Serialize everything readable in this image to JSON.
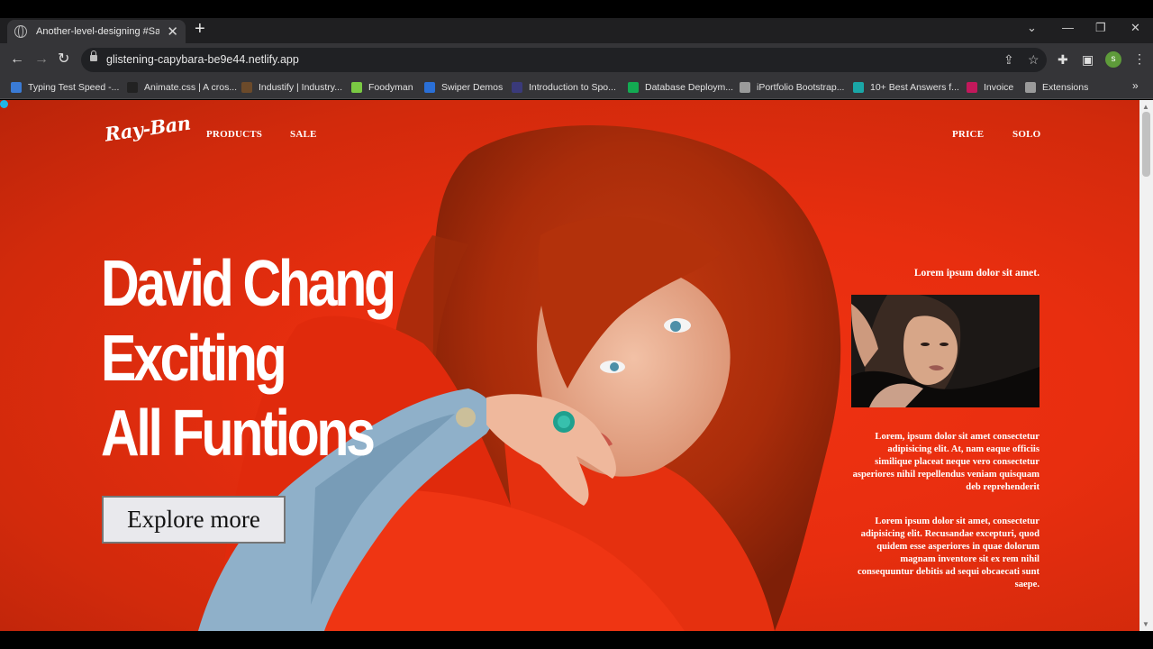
{
  "browser": {
    "tab_title": "Another-level-designing #Sagar",
    "url": "glistening-capybara-be9e44.netlify.app",
    "profile_initial": "s",
    "bookmarks": [
      {
        "label": "Typing Test Speed -...",
        "color": "#3a7bd5"
      },
      {
        "label": "Animate.css | A cros...",
        "color": "#222222"
      },
      {
        "label": "Industify | Industry...",
        "color": "#6b4a2a"
      },
      {
        "label": "Foodyman",
        "color": "#7ac943"
      },
      {
        "label": "Swiper Demos",
        "color": "#2a6fd6"
      },
      {
        "label": "Introduction to Spo...",
        "color": "#3a3a7a"
      },
      {
        "label": "Database Deploym...",
        "color": "#13aa52"
      },
      {
        "label": "iPortfolio Bootstrap...",
        "color": "#9a9a9a"
      },
      {
        "label": "10+ Best Answers f...",
        "color": "#1aa6a6"
      },
      {
        "label": "Invoice",
        "color": "#c2185b"
      },
      {
        "label": "Extensions",
        "color": "#9a9a9a"
      }
    ]
  },
  "page": {
    "logo": "Ray-Ban",
    "nav_left": [
      "PRODUCTS",
      "SALE"
    ],
    "nav_right": [
      "PRICE",
      "SOLO"
    ],
    "headline": [
      "David Chang",
      "Exciting",
      "All Funtions"
    ],
    "cta": "Explore more",
    "side_lead": "Lorem ipsum dolor sit amet.",
    "side_p1": "Lorem, ipsum dolor sit amet consectetur adipisicing elit. At, nam eaque officiis similique placeat neque vero consectetur asperiores nihil repellendus veniam quisquam deb reprehenderit",
    "side_p2": "Lorem ipsum dolor sit amet, consectetur adipisicing elit. Recusandae excepturi, quod quidem esse asperiores in quae dolorum magnam inventore sit ex rem nihil consequuntur debitis ad sequi obcaecati sunt saepe."
  },
  "colors": {
    "hero_red": "#e82e0f",
    "hair": "#b8320c",
    "chrome_dark": "#353538"
  }
}
